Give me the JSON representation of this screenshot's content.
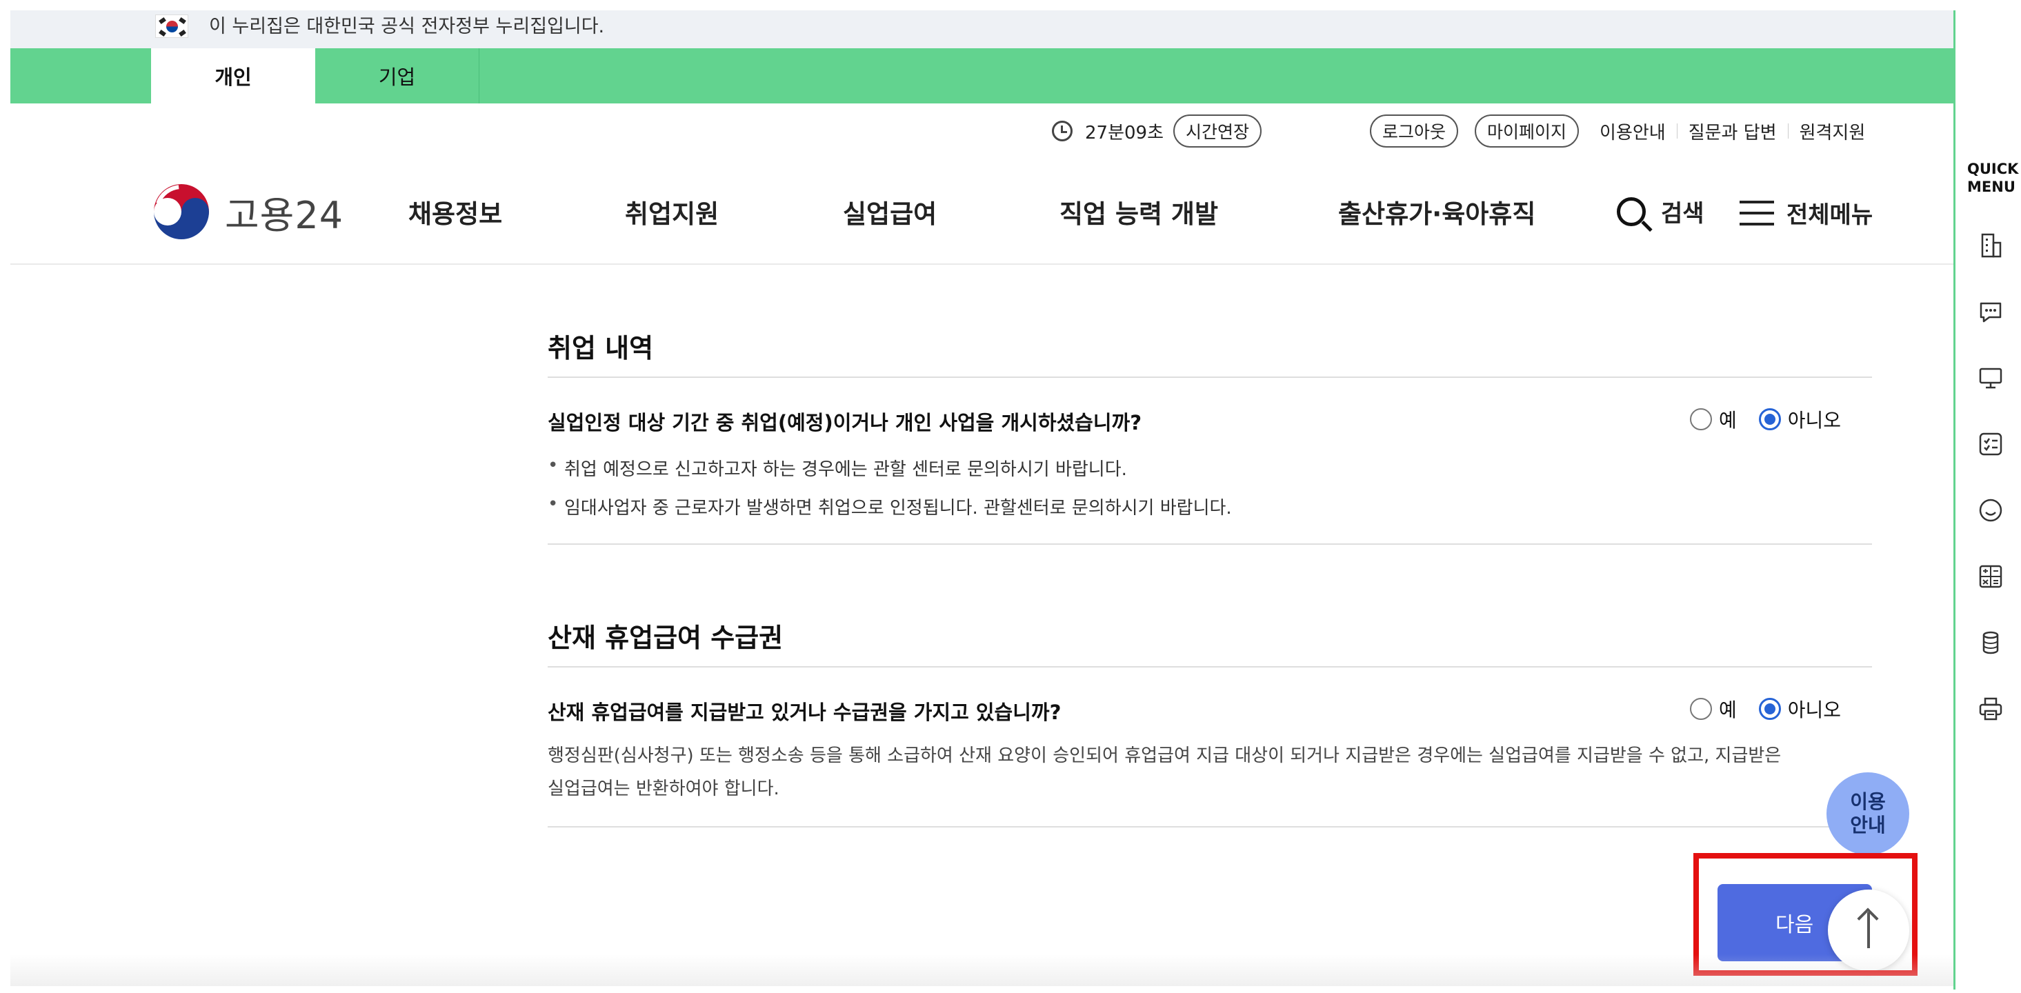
{
  "gov_notice": {
    "text": "이 누리집은 대한민국 공식 전자정부 누리집입니다."
  },
  "tabs": [
    {
      "label": "개인",
      "active": true
    },
    {
      "label": "기업",
      "active": false
    }
  ],
  "utility": {
    "timer": "27분09초",
    "extend_label": "시간연장",
    "logout_label": "로그아웃",
    "mypage_label": "마이페이지",
    "links": [
      "이용안내",
      "질문과 답변",
      "원격지원"
    ]
  },
  "logo": {
    "text": "고용24"
  },
  "nav": {
    "items": [
      "채용정보",
      "취업지원",
      "실업급여",
      "직업 능력 개발",
      "출산휴가·육아휴직"
    ],
    "search_label": "검색",
    "all_menu_label": "전체메뉴"
  },
  "sections": [
    {
      "title": "취업 내역",
      "question": "실업인정 대상 기간 중 취업(예정)이거나 개인 사업을 개시하셨습니까?",
      "yes_label": "예",
      "no_label": "아니오",
      "selected": "아니오",
      "bullets": [
        "취업 예정으로 신고하고자 하는 경우에는 관할 센터로 문의하시기 바랍니다.",
        "임대사업자 중 근로자가 발생하면 취업으로 인정됩니다. 관할센터로 문의하시기 바랍니다."
      ]
    },
    {
      "title": "산재 휴업급여 수급권",
      "question": "산재 휴업급여를 지급받고 있거나 수급권을 가지고 있습니까?",
      "yes_label": "예",
      "no_label": "아니오",
      "selected": "아니오",
      "description_line1": "행정심판(심사청구) 또는 행정소송 등을 통해 소급하여 산재 요양이 승인되어 휴업급여 지급 대상이 되거나 지급받은 경우에는 실업급여를 지급받을 수 없고, 지급받은",
      "description_line2": "실업급여는 반환하여야 합니다."
    }
  ],
  "next_button": {
    "label": "다음"
  },
  "guide_bubble": {
    "line1": "이용",
    "line2": "안내"
  },
  "quick_menu": {
    "title_line1": "QUICK",
    "title_line2": "MENU",
    "icons": [
      "building-icon",
      "chat-icon",
      "monitor-icon",
      "checklist-icon",
      "smile-icon",
      "calculator-icon",
      "coins-icon",
      "printer-icon"
    ]
  },
  "colors": {
    "tab_bar": "#62d38f",
    "primary_button": "#4f6be0",
    "radio_checked": "#2663d6",
    "highlight": "#e41010",
    "guide_bubble": "#8fadf5"
  }
}
